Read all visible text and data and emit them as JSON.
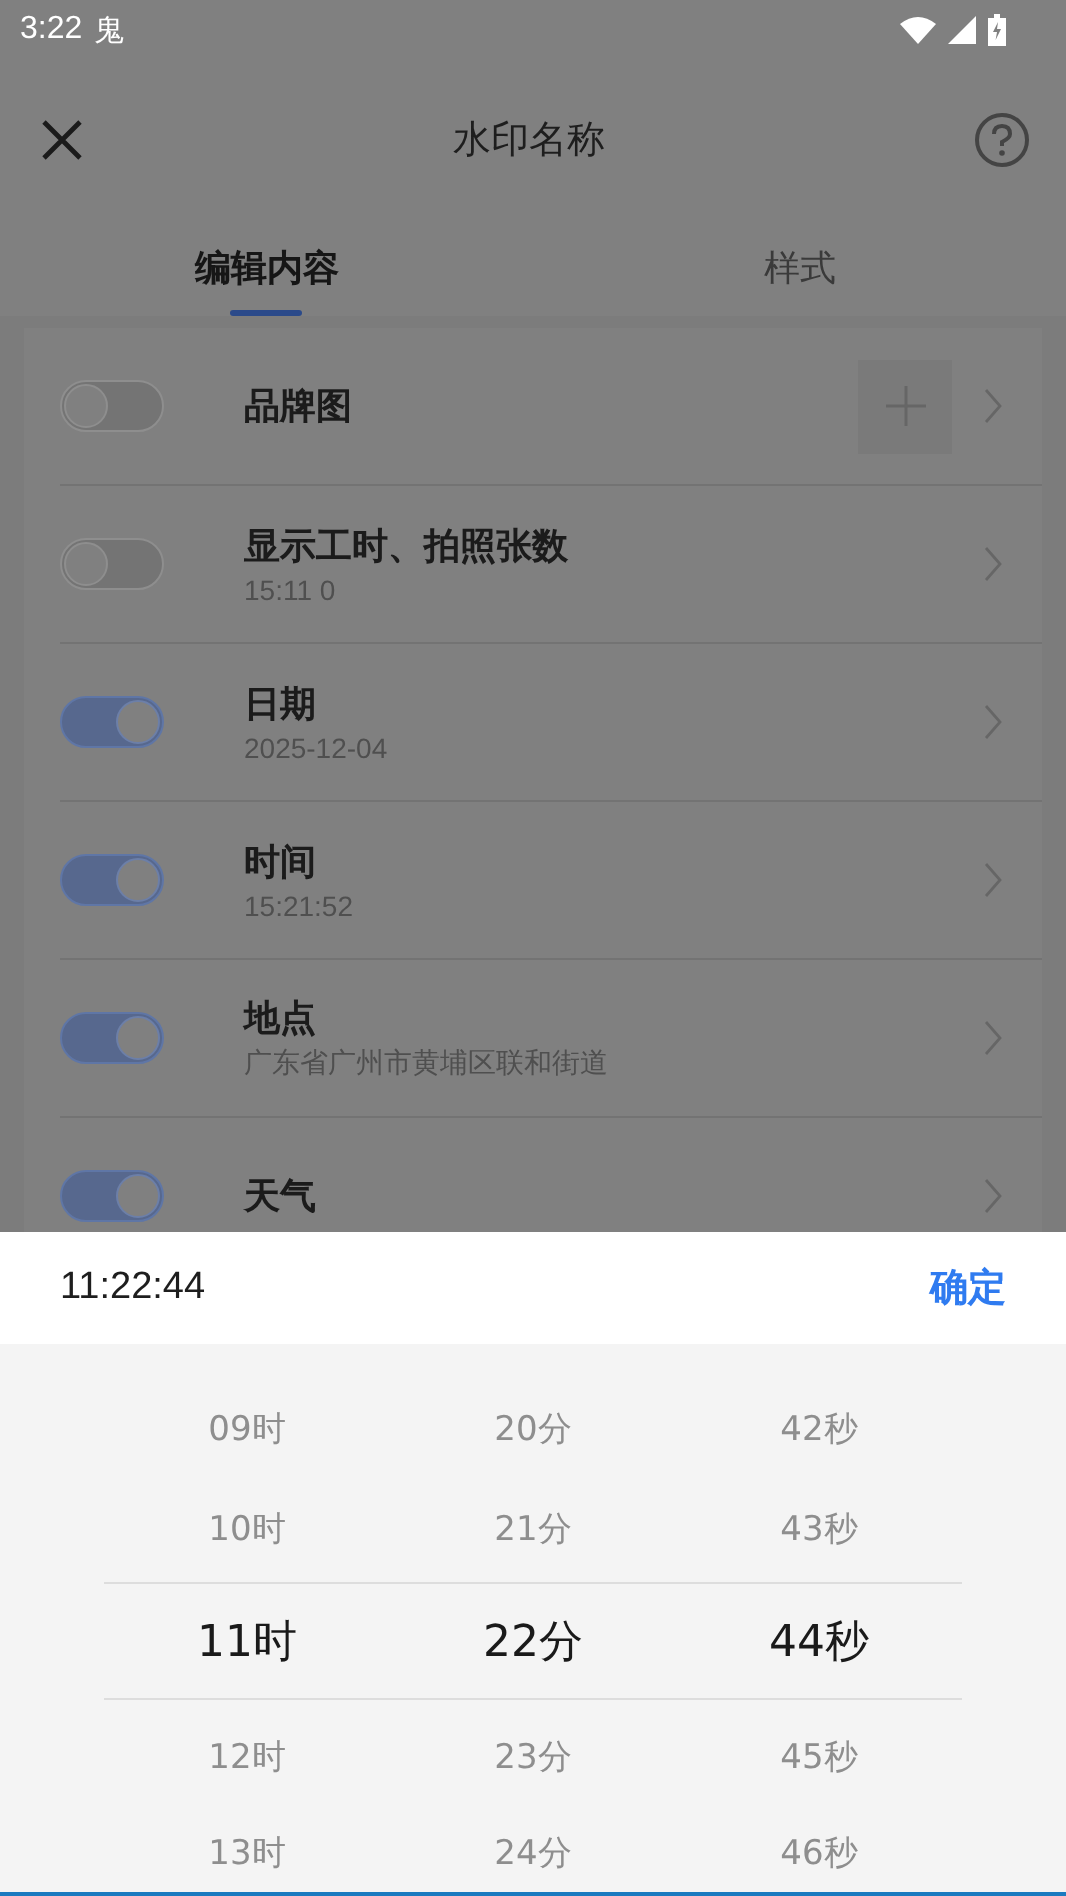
{
  "status_bar": {
    "time": "3:22",
    "app_glyph": "鬼"
  },
  "header": {
    "title": "水印名称"
  },
  "tabs": [
    {
      "label": "编辑内容",
      "selected": true
    },
    {
      "label": "样式",
      "selected": false
    }
  ],
  "items": [
    {
      "kind": "image",
      "title": "品牌图",
      "on": false
    },
    {
      "kind": "detail",
      "title": "显示工时、拍照张数",
      "subtitle": "15:11  0",
      "on": false
    },
    {
      "kind": "detail",
      "title": "日期",
      "subtitle": "2025-12-04",
      "on": true
    },
    {
      "kind": "detail",
      "title": "时间",
      "subtitle": "15:21:52",
      "on": true
    },
    {
      "kind": "detail",
      "title": "地点",
      "subtitle": "广东省广州市黄埔区联和街道",
      "on": true
    },
    {
      "kind": "detail",
      "title": "天气",
      "on": true
    }
  ],
  "picker": {
    "value": "11:22:44",
    "confirm": "确定",
    "columns": [
      [
        {
          "label": "09时",
          "selected": false
        },
        {
          "label": "10时",
          "selected": false
        },
        {
          "label": "11时",
          "selected": true
        },
        {
          "label": "12时",
          "selected": false
        },
        {
          "label": "13时",
          "selected": false
        }
      ],
      [
        {
          "label": "20分",
          "selected": false
        },
        {
          "label": "21分",
          "selected": false
        },
        {
          "label": "22分",
          "selected": true
        },
        {
          "label": "23分",
          "selected": false
        },
        {
          "label": "24分",
          "selected": false
        }
      ],
      [
        {
          "label": "42秒",
          "selected": false
        },
        {
          "label": "43秒",
          "selected": false
        },
        {
          "label": "44秒",
          "selected": true
        },
        {
          "label": "45秒",
          "selected": false
        },
        {
          "label": "46秒",
          "selected": false
        }
      ]
    ]
  }
}
